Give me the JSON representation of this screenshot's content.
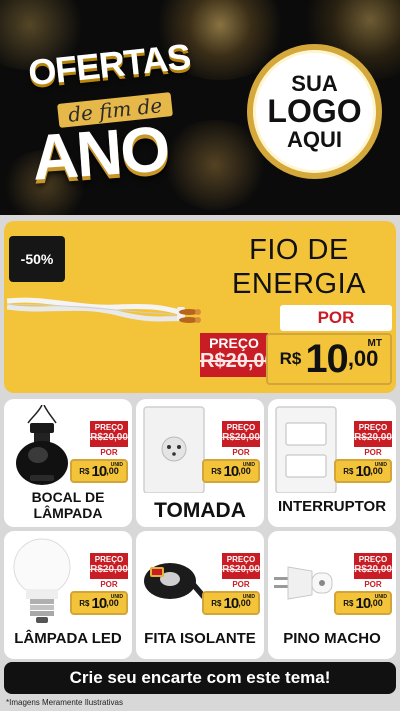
{
  "header": {
    "title_line1": "OFERTAS",
    "title_line2": "de fim de",
    "title_line3": "ANO",
    "logo": {
      "line1": "SUA",
      "line2": "LOGO",
      "line3": "AQUI"
    }
  },
  "featured": {
    "discount": "-50%",
    "title_line1": "FIO DE",
    "title_line2": "ENERGIA",
    "price": {
      "de_label": "PREÇO",
      "old_price": "R$20,00",
      "por_label": "POR",
      "currency": "R$",
      "whole": "10",
      "cents": ",00",
      "unit": "MT"
    }
  },
  "products": [
    {
      "name": "BOCAL DE LÂMPADA",
      "de_label": "PREÇO",
      "old_price": "R$20,00",
      "por_label": "POR",
      "currency": "R$",
      "whole": "10",
      "cents": ",00",
      "unit": "UNID"
    },
    {
      "name": "TOMADA",
      "de_label": "PREÇO",
      "old_price": "R$20,00",
      "por_label": "POR",
      "currency": "R$",
      "whole": "10",
      "cents": ",00",
      "unit": "UNID"
    },
    {
      "name": "INTERRUPTOR",
      "de_label": "PREÇO",
      "old_price": "R$20,00",
      "por_label": "POR",
      "currency": "R$",
      "whole": "10",
      "cents": ",00",
      "unit": "UNID"
    },
    {
      "name": "LÂMPADA LED",
      "de_label": "PREÇO",
      "old_price": "R$20,00",
      "por_label": "POR",
      "currency": "R$",
      "whole": "10",
      "cents": ",00",
      "unit": "UNID"
    },
    {
      "name": "FITA ISOLANTE",
      "de_label": "PREÇO",
      "old_price": "R$20,00",
      "por_label": "POR",
      "currency": "R$",
      "whole": "10",
      "cents": ",00",
      "unit": "UNID"
    },
    {
      "name": "PINO MACHO",
      "de_label": "PREÇO",
      "old_price": "R$20,00",
      "por_label": "POR",
      "currency": "R$",
      "whole": "10",
      "cents": ",00",
      "unit": "UNID"
    }
  ],
  "footer": {
    "cta": "Crie seu encarte com este tema!",
    "disclaimer": "*Imagens Meramente Ilustrativas"
  },
  "colors": {
    "accent_gold": "#f3c33a",
    "price_red": "#c81d25",
    "header_bg": "#0b0b0b",
    "page_bg": "#d8d8d8"
  },
  "icons": [
    "wire-cable-image",
    "lamp-socket-image",
    "power-outlet-image",
    "light-switch-image",
    "led-bulb-image",
    "insulating-tape-image",
    "male-plug-image"
  ]
}
